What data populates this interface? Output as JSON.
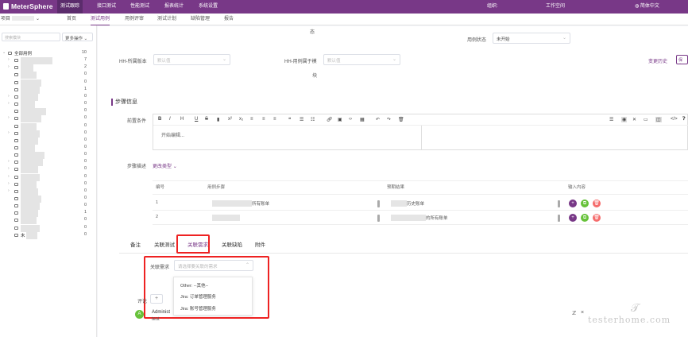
{
  "brand": {
    "logo": "MeterSphere"
  },
  "top_nav": {
    "items": [
      "测试跟踪",
      "接口测试",
      "性能测试",
      "报表统计",
      "系统设置"
    ],
    "org_label": "组织:",
    "workspace_label": "工作空间",
    "language": "简体中文"
  },
  "sub_nav": {
    "project": "项目",
    "items": [
      "首页",
      "测试用例",
      "用例评审",
      "测试计划",
      "缺陷管理",
      "报告"
    ]
  },
  "sidebar": {
    "search_placeholder": "搜索模块",
    "more_label": "更多操作",
    "root_label": "全部用例",
    "root_count": "10",
    "last_label": "未",
    "items": [
      {
        "count": "7"
      },
      {
        "count": "2"
      },
      {
        "count": "0"
      },
      {
        "count": "0"
      },
      {
        "count": "1"
      },
      {
        "count": "0"
      },
      {
        "count": "0"
      },
      {
        "count": "0"
      },
      {
        "count": "0"
      },
      {
        "count": "0"
      },
      {
        "count": "0"
      },
      {
        "count": "0"
      },
      {
        "count": "0"
      },
      {
        "count": "0"
      },
      {
        "count": "0"
      },
      {
        "count": "0"
      },
      {
        "count": "0"
      },
      {
        "count": "0"
      },
      {
        "count": "0"
      },
      {
        "count": "0"
      },
      {
        "count": "0"
      },
      {
        "count": "1"
      },
      {
        "count": "0"
      },
      {
        "count": "0"
      },
      {
        "count": "0"
      }
    ]
  },
  "form": {
    "status_frag": "态",
    "case_status_label": "用例状态",
    "case_status_value": "未开始",
    "field1_label": "HH-所属版本",
    "field1_placeholder": "默认值",
    "field2_label": "HH-用例属于模",
    "field2_label_cont": "块",
    "field2_placeholder": "默认值",
    "change_history": "变更历史",
    "save_frag": "保存"
  },
  "steps_section": {
    "title": "步骤信息",
    "precondition_label": "前置条件",
    "editor_placeholder": "开始编辑...",
    "step_desc_label": "步骤描述",
    "change_type": "更改类型",
    "columns": [
      "编号",
      "用例步骤",
      "预期结果",
      "输入内容"
    ],
    "rows": [
      {
        "num": "1",
        "step_suffix": "所有账单",
        "expected_suffix": "历史账单"
      },
      {
        "num": "2",
        "step_suffix": "",
        "expected_suffix": "的所有账单"
      }
    ]
  },
  "tabs": {
    "items": [
      "备注",
      "关联测试",
      "关联需求",
      "关联缺陷",
      "附件"
    ],
    "active": "关联需求"
  },
  "requirement": {
    "label": "关联需求",
    "placeholder": "请选择要关联的需求",
    "options": [
      "Other: --其他--",
      "Jira: 订单管理服务",
      "Jira: 账号管理服务"
    ]
  },
  "comment": {
    "label": "评论",
    "user_frag": "Administ",
    "text_frag": "test",
    "avatar_letter": "A"
  },
  "watermark": "testerhome.com",
  "colors": {
    "brand": "#783887",
    "highlight": "#e22222",
    "btn_purple": "#783887",
    "btn_green": "#67c23a",
    "btn_red": "#f56c6c"
  }
}
